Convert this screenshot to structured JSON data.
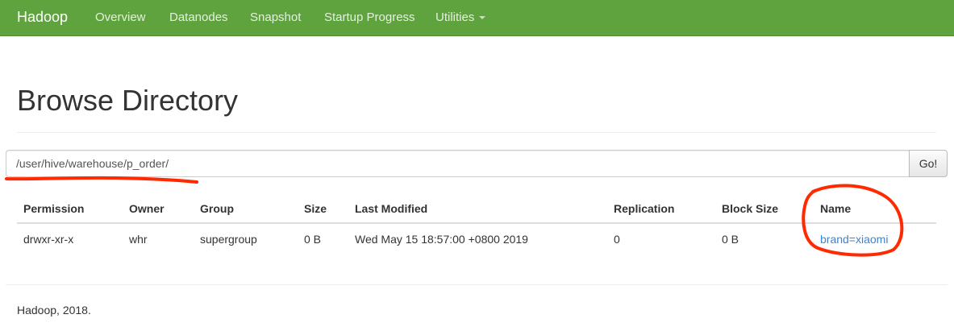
{
  "navbar": {
    "brand": "Hadoop",
    "items": [
      {
        "label": "Overview"
      },
      {
        "label": "Datanodes"
      },
      {
        "label": "Snapshot"
      },
      {
        "label": "Startup Progress"
      },
      {
        "label": "Utilities"
      }
    ],
    "color": "#5fa33e"
  },
  "page": {
    "title": "Browse Directory"
  },
  "directory": {
    "path": "/user/hive/warehouse/p_order/",
    "go_label": "Go!"
  },
  "table": {
    "headers": [
      "Permission",
      "Owner",
      "Group",
      "Size",
      "Last Modified",
      "Replication",
      "Block Size",
      "Name"
    ],
    "rows": [
      [
        "drwxr-xr-x",
        "whr",
        "supergroup",
        "0 B",
        "Wed May 15 18:57:00 +0800 2019",
        "0",
        "0 B",
        "brand=xiaomi"
      ]
    ]
  },
  "footer": {
    "text": "Hadoop, 2018."
  },
  "annotations": {
    "color": "#ff2a00"
  },
  "icons": {
    "utilities_dropdown": "caret-down-icon"
  }
}
